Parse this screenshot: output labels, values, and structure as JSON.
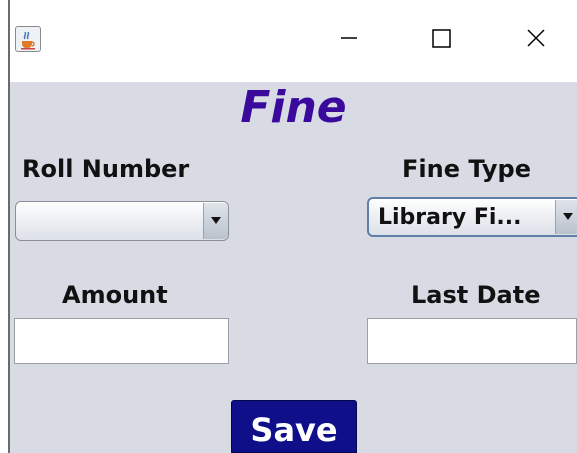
{
  "window": {
    "icon": "java-cup-icon",
    "controls": [
      "minimize-icon",
      "maximize-icon",
      "close-icon"
    ]
  },
  "form": {
    "title": "Fine",
    "roll_number": {
      "label": "Roll Number",
      "value": ""
    },
    "fine_type": {
      "label": "Fine Type",
      "value": "Library Fi..."
    },
    "amount": {
      "label": "Amount",
      "value": ""
    },
    "last_date": {
      "label": "Last Date",
      "value": ""
    },
    "save_label": "Save"
  },
  "colors": {
    "title": "#3a0a9c",
    "panel_bg": "#d8dbe3",
    "save_button_bg": "#0f0f8a"
  }
}
